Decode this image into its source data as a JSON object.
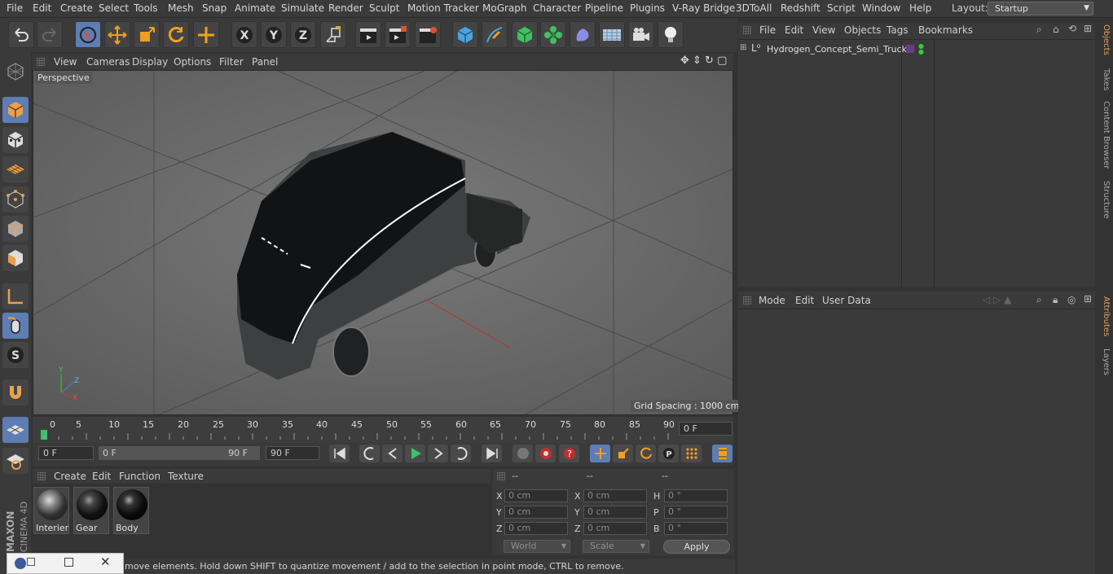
{
  "menu": [
    "File",
    "Edit",
    "Create",
    "Select",
    "Tools",
    "Mesh",
    "Snap",
    "Animate",
    "Simulate",
    "Render",
    "Sculpt",
    "Motion Tracker",
    "MoGraph",
    "Character",
    "Pipeline",
    "Plugins",
    "V-Ray Bridge",
    "3DToAll",
    "Redshift",
    "Script",
    "Window",
    "Help"
  ],
  "layout": {
    "label": "Layout:",
    "value": "Startup"
  },
  "viewport": {
    "menu": [
      "View",
      "Cameras",
      "Display",
      "Options",
      "Filter",
      "Panel"
    ],
    "camera_label": "Perspective",
    "grid_spacing": "Grid Spacing : 1000 cm"
  },
  "timeline": {
    "ticks": [
      "0",
      "5",
      "10",
      "15",
      "20",
      "25",
      "30",
      "35",
      "40",
      "45",
      "50",
      "55",
      "60",
      "65",
      "70",
      "75",
      "80",
      "85",
      "90"
    ],
    "current_frame": "0 F"
  },
  "transport": {
    "start": "0 F",
    "range_start": "0 F",
    "range_end": "90 F",
    "end": "90 F"
  },
  "materials": {
    "menu": [
      "Create",
      "Edit",
      "Function",
      "Texture"
    ],
    "items": [
      "Interier",
      "Gear",
      "Body"
    ]
  },
  "coords": {
    "headers": [
      "--",
      "--",
      "--"
    ],
    "pos": {
      "x": "0 cm",
      "y": "0 cm",
      "z": "0 cm"
    },
    "size": {
      "x": "0 cm",
      "y": "0 cm",
      "z": "0 cm"
    },
    "rot": {
      "h": "0 °",
      "p": "0 °",
      "b": "0 °"
    },
    "axis_labels": {
      "x": "X",
      "y": "Y",
      "z": "Z",
      "h": "H",
      "p": "P",
      "b": "B"
    },
    "space": "World",
    "mode": "Scale",
    "apply": "Apply"
  },
  "status": "move elements. Hold down SHIFT to quantize movement / add to the selection in point mode, CTRL to remove.",
  "objects": {
    "menu": [
      "File",
      "Edit",
      "View",
      "Objects",
      "Tags",
      "Bookmarks"
    ],
    "items": [
      {
        "name": "Hydrogen_Concept_Semi_Truck"
      }
    ]
  },
  "attributes": {
    "menu": [
      "Mode",
      "Edit",
      "User Data"
    ]
  },
  "right_tabs": [
    "Objects",
    "Takes",
    "Content Browser",
    "Structure",
    "Attributes",
    "Layers"
  ],
  "brand": {
    "maxon": "MAXON",
    "cinema": "CINEMA 4D"
  },
  "colors": {
    "accent": "#5d7db3",
    "background": "#333333",
    "viewport": "#6b6b6b",
    "play": "#35c46a"
  }
}
